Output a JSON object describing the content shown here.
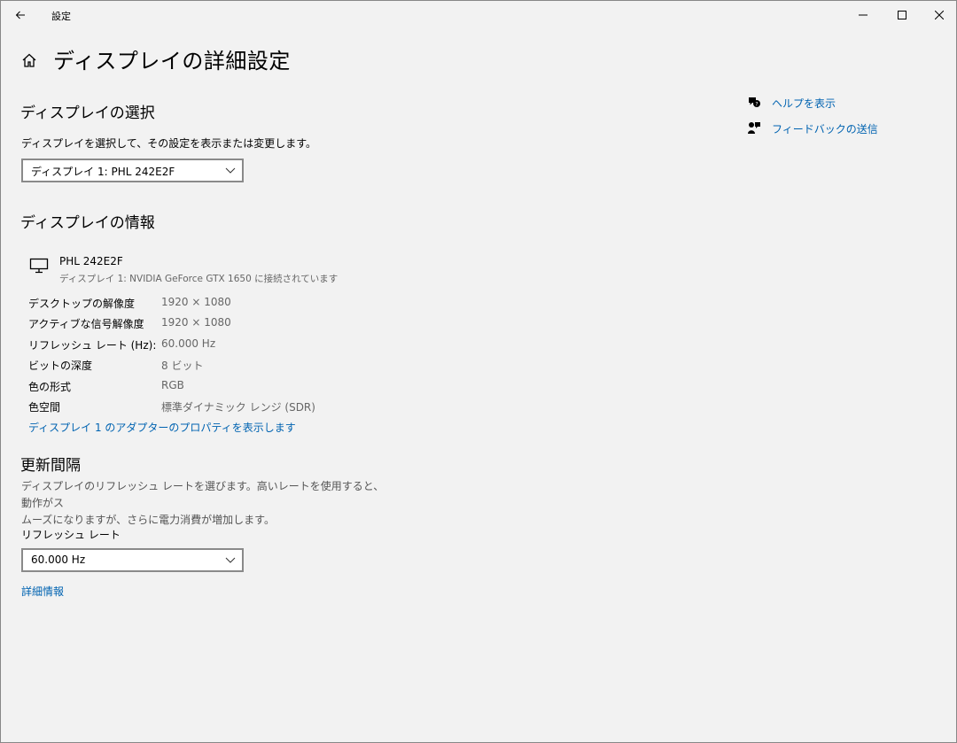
{
  "window": {
    "title": "設定"
  },
  "page": {
    "title": "ディスプレイの詳細設定"
  },
  "select_display": {
    "heading": "ディスプレイの選択",
    "description": "ディスプレイを選択して、その設定を表示または変更します。",
    "selected": "ディスプレイ 1: PHL 242E2F"
  },
  "display_info": {
    "heading": "ディスプレイの情報",
    "monitor_name": "PHL 242E2F",
    "monitor_sub": "ディスプレイ 1: NVIDIA GeForce GTX 1650 に接続されています",
    "rows": [
      {
        "label": "デスクトップの解像度",
        "value": "1920 × 1080"
      },
      {
        "label": "アクティブな信号解像度",
        "value": "1920 × 1080"
      },
      {
        "label": "リフレッシュ レート (Hz):",
        "value": "60.000 Hz"
      },
      {
        "label": "ビットの深度",
        "value": "8 ビット"
      },
      {
        "label": "色の形式",
        "value": "RGB"
      },
      {
        "label": "色空間",
        "value": "標準ダイナミック レンジ (SDR)"
      }
    ],
    "adapter_link": "ディスプレイ 1 のアダプターのプロパティを表示します"
  },
  "refresh": {
    "heading": "更新間隔",
    "description_line1": "ディスプレイのリフレッシュ レートを選びます。高いレートを使用すると、動作がス",
    "description_line2": "ムーズになりますが、さらに電力消費が増加します。",
    "rate_label": "リフレッシュ レート",
    "rate_selected": "60.000 Hz",
    "details_link": "詳細情報"
  },
  "side": {
    "help_label": "ヘルプを表示",
    "feedback_label": "フィードバックの送信"
  },
  "icons": {
    "back": "back-arrow-icon",
    "home": "home-icon",
    "minimize": "minimize-icon",
    "maximize": "maximize-icon",
    "close": "close-icon",
    "chevron": "chevron-down-icon",
    "monitor": "monitor-icon",
    "help": "help-icon",
    "feedback": "feedback-icon"
  },
  "colors": {
    "link": "#0063b1",
    "background": "#f2f2f2"
  }
}
